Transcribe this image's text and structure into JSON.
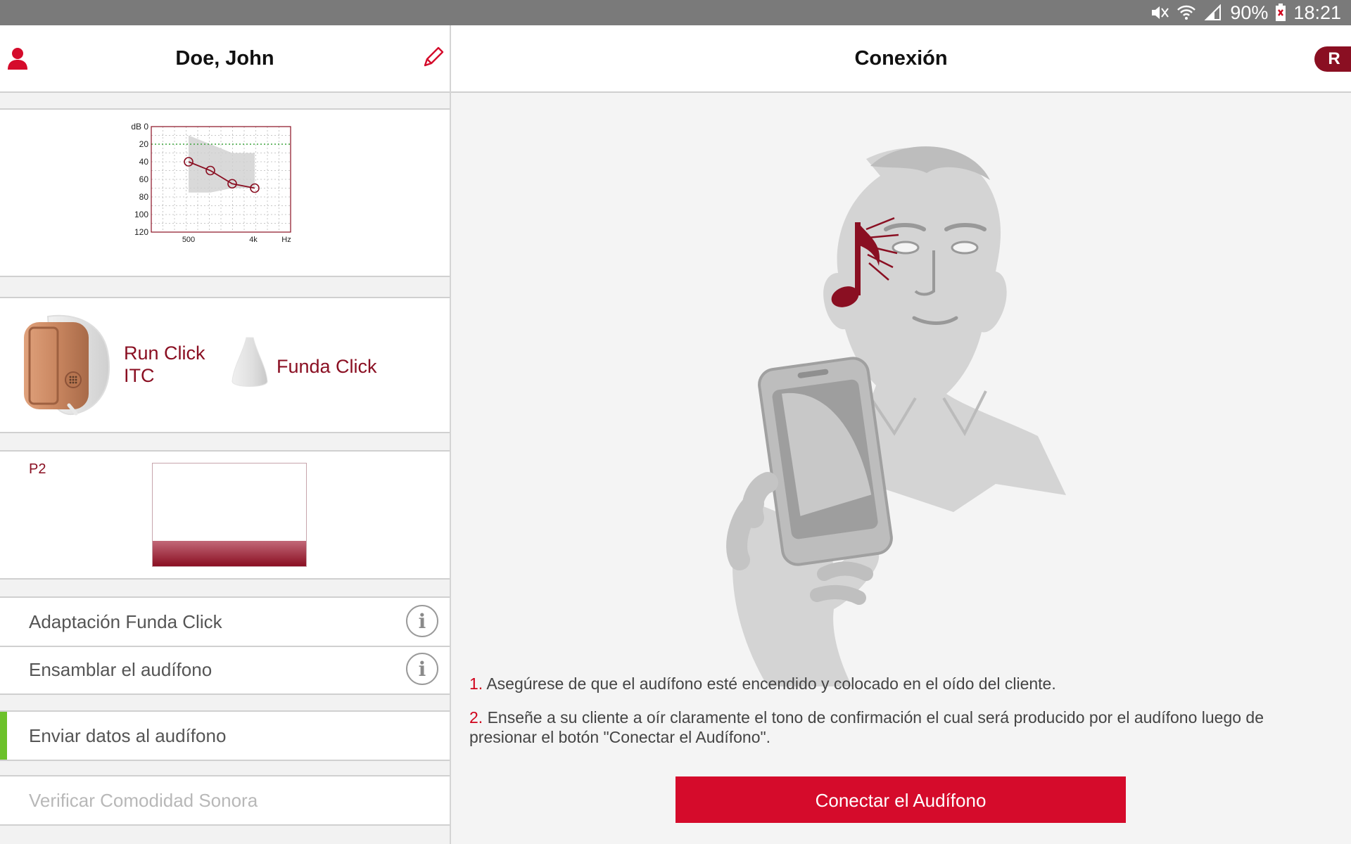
{
  "status_bar": {
    "battery": "90%",
    "time": "18:21"
  },
  "patient_header": {
    "name": "Doe, John"
  },
  "audiogram": {
    "y_labels": [
      "dB 0",
      "20",
      "40",
      "60",
      "80",
      "100",
      "120"
    ],
    "x_labels": [
      "500",
      "4k",
      "Hz"
    ]
  },
  "chart_data": {
    "type": "line",
    "x": [
      "500",
      "1k",
      "2k",
      "4k"
    ],
    "series": [
      {
        "values": [
          40,
          50,
          65,
          70
        ]
      }
    ],
    "ylim": [
      0,
      120
    ],
    "y_inverted": true,
    "shaded_band": {
      "from_x": "500",
      "to_x": "4k"
    },
    "reference_line": 20
  },
  "device": {
    "model_line1": "Run Click",
    "model_line2": "ITC",
    "dome_label": "Funda Click"
  },
  "program": {
    "label": "P2",
    "fill_fraction": 0.25
  },
  "steps": [
    {
      "label": "Adaptación Funda Click",
      "has_info": true,
      "active": false,
      "disabled": false
    },
    {
      "label": "Ensamblar el audífono",
      "has_info": true,
      "active": false,
      "disabled": false
    },
    {
      "label": "Enviar datos al audífono",
      "has_info": false,
      "active": true,
      "disabled": false
    },
    {
      "label": "Verificar Comodidad Sonora",
      "has_info": false,
      "active": false,
      "disabled": true
    }
  ],
  "connection": {
    "title": "Conexión",
    "badge": "R",
    "instructions": [
      {
        "num": "1.",
        "text": "Asegúrese de que el audífono esté encendido y colocado en el oído del cliente."
      },
      {
        "num": "2.",
        "text": "Enseñe a su cliente a oír claramente el tono de confirmación el cual será producido por el audífono luego de presionar el botón \"Conectar el Audífono\"."
      }
    ],
    "button_label": "Conectar el Audífono"
  },
  "colors": {
    "accent": "#8a0f22",
    "button": "#d50b2b",
    "active_marker": "#6cc12a",
    "status_bar": "#7a7a7a"
  }
}
